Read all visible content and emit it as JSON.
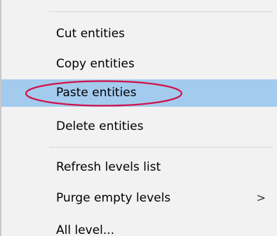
{
  "context_menu": {
    "items": [
      {
        "label": "Cut entities"
      },
      {
        "label": "Copy entities"
      },
      {
        "label": "Paste entities",
        "state": "hover"
      },
      {
        "label": "Delete entities"
      },
      {
        "label": "Refresh levels list"
      },
      {
        "label": "Purge empty levels",
        "submenu_indicator": ">"
      },
      {
        "label": "All level..."
      }
    ]
  },
  "colors": {
    "menu_background": "#f2f2f2",
    "hover_background": "#a3cbee",
    "separator": "#d6d6d6",
    "annotation_circle": "#d0134a"
  }
}
